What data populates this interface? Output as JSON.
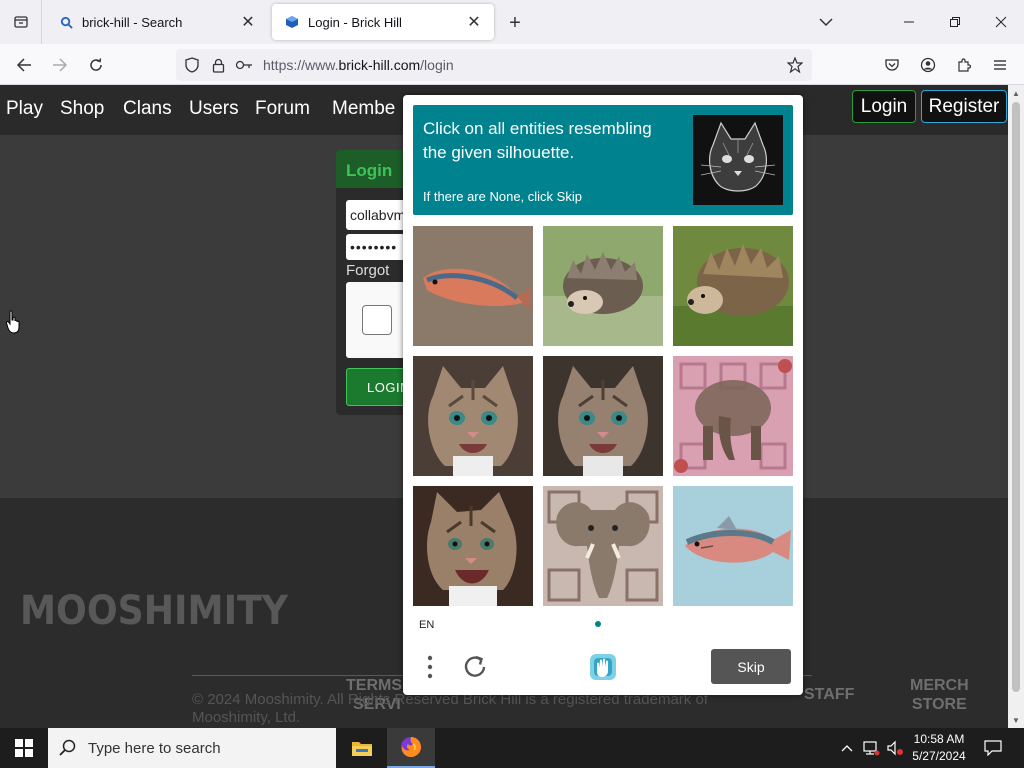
{
  "browser": {
    "tabs": [
      {
        "label": "brick-hill - Search",
        "active": false
      },
      {
        "label": "Login - Brick Hill",
        "active": true
      }
    ],
    "url_prefix": "https://www.",
    "url_domain": "brick-hill.com",
    "url_path": "/login"
  },
  "site": {
    "nav": [
      "Play",
      "Shop",
      "Clans",
      "Users",
      "Forum",
      "Membe"
    ],
    "login_button": "Login",
    "register_button": "Register",
    "login_card": {
      "header": "Login",
      "username_value": "collabvm",
      "password_mask": "••••••••",
      "forgot_label": "Forgot",
      "login_button": "LOGIN"
    },
    "footer": {
      "logo_text": "MOOSHIMITY",
      "terms_line1": "TERMS",
      "terms_line2": "SERVI",
      "staff_label": "STAFF",
      "merch_line1": "MERCH",
      "merch_line2": "STORE",
      "copyright_line1": "© 2024 Mooshimity. All Rights Reserved Brick Hill     is a registered trademark of",
      "copyright_line2": "Mooshimity, Ltd."
    }
  },
  "captcha": {
    "prompt": "Click on all entities resembling the given silhouette.",
    "subprompt": "If there are None, click Skip",
    "tiles": [
      "fish",
      "hedgehog",
      "hedgehog",
      "cat",
      "cat",
      "elephant",
      "cat",
      "elephant",
      "fish"
    ],
    "language": "EN",
    "skip_label": "Skip"
  },
  "taskbar": {
    "search_placeholder": "Type here to search",
    "time": "10:58 AM",
    "date": "5/27/2024"
  },
  "colors": {
    "captcha_prompt_bg": "#00838f",
    "login_green": "#1c7a2f",
    "register_blue": "#2da8d8"
  }
}
